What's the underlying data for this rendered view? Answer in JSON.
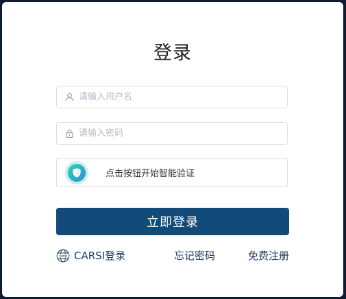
{
  "login": {
    "title": "登录",
    "username_placeholder": "请输入用户名",
    "password_placeholder": "请输入密码",
    "captcha_text": "点击按钮开始智能验证",
    "submit_label": "立即登录",
    "carsi_label": "CARSI登录",
    "carsi_icon_text": "CARSI",
    "forgot_label": "忘记密码",
    "register_label": "免费注册"
  },
  "icons": {
    "username": "user-icon",
    "password": "lock-icon",
    "captcha": "shield-check-icon",
    "carsi": "globe-icon"
  },
  "colors": {
    "primary": "#124a7a",
    "background": "#0f1a33",
    "link": "#1f3a5c",
    "captcha_accent": "#2fd3b5"
  }
}
